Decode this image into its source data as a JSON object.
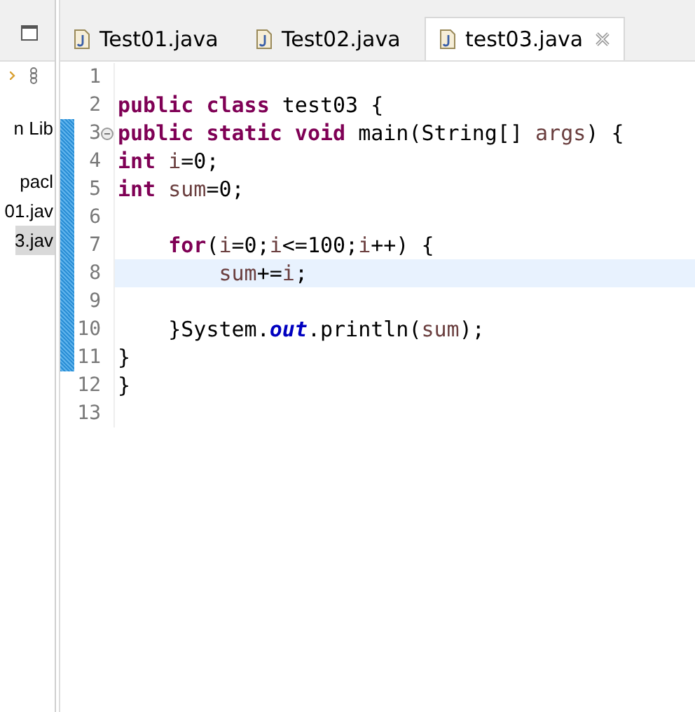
{
  "explorer": {
    "items": [
      {
        "label": "n Lib",
        "selected": false
      },
      {
        "label": "pacl",
        "selected": false
      },
      {
        "label": "01.jav",
        "selected": false
      },
      {
        "label": "3.jav",
        "selected": true
      }
    ]
  },
  "tabs": [
    {
      "label": "Test01.java",
      "selected": false,
      "closable": false
    },
    {
      "label": "Test02.java",
      "selected": false,
      "closable": false
    },
    {
      "label": "test03.java",
      "selected": true,
      "closable": true
    }
  ],
  "editor": {
    "lines": [
      {
        "number": "1",
        "changed": false,
        "current": false,
        "foldable": false
      },
      {
        "number": "2",
        "changed": false,
        "current": false,
        "foldable": false,
        "tokens": [
          {
            "text": "public",
            "kind": "keyword"
          },
          {
            "text": " class",
            "kind": "keyword"
          },
          {
            "text": " test03 {",
            "kind": "plain"
          }
        ]
      },
      {
        "number": "3",
        "changed": true,
        "current": false,
        "foldable": true,
        "tokens": [
          {
            "text": "public",
            "kind": "keyword"
          },
          {
            "text": " static",
            "kind": "keyword"
          },
          {
            "text": " void",
            "kind": "keyword"
          },
          {
            "text": " main(String[] ",
            "kind": "plain"
          },
          {
            "text": "args",
            "kind": "variable"
          },
          {
            "text": ") {",
            "kind": "plain"
          }
        ]
      },
      {
        "number": "4",
        "changed": true,
        "current": false,
        "foldable": false,
        "tokens": [
          {
            "text": "int",
            "kind": "keyword"
          },
          {
            "text": " i",
            "kind": "variable"
          },
          {
            "text": "=0;",
            "kind": "plain"
          }
        ]
      },
      {
        "number": "5",
        "changed": true,
        "current": false,
        "foldable": false,
        "tokens": [
          {
            "text": "int",
            "kind": "keyword"
          },
          {
            "text": " sum",
            "kind": "variable"
          },
          {
            "text": "=0;",
            "kind": "plain"
          }
        ]
      },
      {
        "number": "6",
        "changed": true,
        "current": false,
        "foldable": false
      },
      {
        "number": "7",
        "changed": true,
        "current": false,
        "foldable": false,
        "tokens": [
          {
            "text": "    for",
            "kind": "keyword"
          },
          {
            "text": "(",
            "kind": "plain"
          },
          {
            "text": "i",
            "kind": "variable"
          },
          {
            "text": "=0;",
            "kind": "plain"
          },
          {
            "text": "i",
            "kind": "variable"
          },
          {
            "text": "<=100;",
            "kind": "plain"
          },
          {
            "text": "i",
            "kind": "variable"
          },
          {
            "text": "++) {",
            "kind": "plain"
          }
        ]
      },
      {
        "number": "8",
        "changed": true,
        "current": true,
        "foldable": false,
        "tokens": [
          {
            "text": "        sum",
            "kind": "variable"
          },
          {
            "text": "+=",
            "kind": "plain"
          },
          {
            "text": "i",
            "kind": "variable"
          },
          {
            "text": ";",
            "kind": "plain"
          }
        ]
      },
      {
        "number": "9",
        "changed": true,
        "current": false,
        "foldable": false
      },
      {
        "number": "10",
        "changed": true,
        "current": false,
        "foldable": false,
        "tokens": [
          {
            "text": "    }System.",
            "kind": "plain"
          },
          {
            "text": "out",
            "kind": "field"
          },
          {
            "text": ".println(",
            "kind": "plain"
          },
          {
            "text": "sum",
            "kind": "variable"
          },
          {
            "text": ");",
            "kind": "plain"
          }
        ]
      },
      {
        "number": "11",
        "changed": true,
        "current": false,
        "foldable": false,
        "tokens": [
          {
            "text": "}",
            "kind": "plain"
          }
        ]
      },
      {
        "number": "12",
        "changed": false,
        "current": false,
        "foldable": false,
        "tokens": [
          {
            "text": "}",
            "kind": "plain"
          }
        ]
      },
      {
        "number": "13",
        "changed": false,
        "current": false,
        "foldable": false
      }
    ]
  }
}
